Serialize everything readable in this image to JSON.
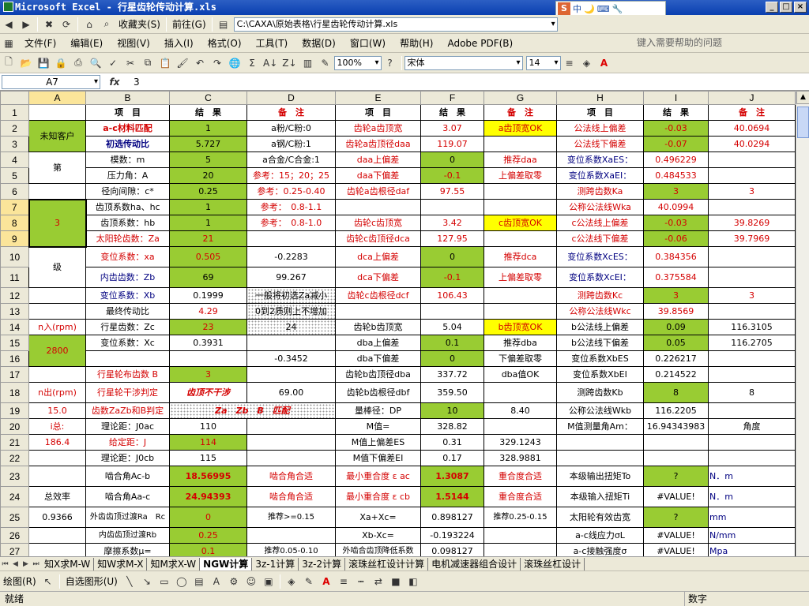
{
  "window": {
    "title": "Microsoft Excel - 行星齿轮传动计算.xls"
  },
  "ime": {
    "label1": "中",
    "label2": "🌙"
  },
  "nav": {
    "favorites": "收藏夹(S)",
    "goto": "前往(G)",
    "address": "C:\\CAXA\\原始表格\\行星齿轮传动计算.xls"
  },
  "menu": {
    "items": [
      "文件(F)",
      "编辑(E)",
      "视图(V)",
      "插入(I)",
      "格式(O)",
      "工具(T)",
      "数据(D)",
      "窗口(W)",
      "帮助(H)",
      "Adobe PDF(B)"
    ],
    "help_placeholder": "键入需要帮助的问题"
  },
  "toolbar": {
    "zoom": "100%",
    "font": "宋体",
    "size": "14"
  },
  "formula": {
    "cell": "A7",
    "fx": "fx",
    "value": "3"
  },
  "columns": [
    "A",
    "B",
    "C",
    "D",
    "E",
    "F",
    "G",
    "H",
    "I",
    "J"
  ],
  "rows": {
    "r1": [
      "",
      "项　目",
      "结　果",
      "备　注",
      "项　目",
      "结　果",
      "备　注",
      "项　目",
      "结　果",
      "备　注"
    ],
    "r2": [
      "a-c材料匹配",
      "1",
      "a粉/C粉:0",
      "齿轮a齿顶宽",
      "3.07",
      "a齿顶宽OK",
      "公法线上偏差",
      "-0.03",
      "40.0694"
    ],
    "r3": [
      "初选传动比",
      "5.727",
      "a钢/C粉:1",
      "齿轮a齿顶径daa",
      "119.07",
      "公法线下偏差",
      "-0.07",
      "40.0294"
    ],
    "r4": [
      "模数：m",
      "5",
      "a合金/C合金:1",
      "daa上偏差",
      "0",
      "推荐daa",
      "变位系数XaES：",
      "0.496229"
    ],
    "r5": [
      "压力角：A",
      "20",
      "参考：15；20；25",
      "daa下偏差",
      "-0.1",
      "上偏差取零",
      "变位系数XaEI：",
      "0.484533"
    ],
    "r6": [
      "径向间隙：c*",
      "0.25",
      "参考：0.25-0.40",
      "齿轮a齿根径daf",
      "97.55",
      "测跨齿数Ka",
      "3",
      "3"
    ],
    "r7": [
      "齿顶系数ha、hc",
      "1",
      "参考：　0.8-1.1",
      "公称公法线Wka",
      "40.0994"
    ],
    "r8": [
      "齿顶系数：hb",
      "1",
      "参考：　0.8-1.0",
      "齿轮c齿顶宽",
      "3.42",
      "c齿顶宽OK",
      "c公法线上偏差",
      "-0.03",
      "39.8269"
    ],
    "r9": [
      "太阳轮齿数：Za",
      "21",
      "齿轮c齿顶径dca",
      "127.95",
      "c公法线下偏差",
      "-0.06",
      "39.7969"
    ],
    "r10": [
      "变位系数：xa",
      "0.505",
      "-0.2283",
      "dca上偏差",
      "0",
      "推荐dca",
      "变位系数XcES：",
      "0.384356"
    ],
    "r11": [
      "内齿齿数：Zb",
      "69",
      "99.267",
      "dca下偏差",
      "-0.1",
      "上偏差取零",
      "变位系数XcEI：",
      "0.375584"
    ],
    "r12": [
      "变位系数：Xb",
      "0.1999",
      "一般将初选Za减小",
      "齿轮c齿根径dcf",
      "106.43",
      "测跨齿数Kc",
      "3",
      "3"
    ],
    "r13": [
      "最终传动比",
      "4.29",
      "0到2质则上不增加",
      "公称公法线Wkc",
      "39.8569"
    ],
    "r14": [
      "行星齿数：Zc",
      "23",
      "24",
      "齿轮b齿顶宽",
      "5.04",
      "b齿顶宽OK",
      "b公法线上偏差",
      "0.09",
      "116.3105"
    ],
    "r15": [
      "变位系数：Xc",
      "0.3931",
      "dba上偏差",
      "0.1",
      "推荐dba",
      "b公法线下偏差",
      "0.05",
      "116.2705"
    ],
    "r16": [
      "-0.3452",
      "dba下偏差",
      "0",
      "下偏差取零",
      "变位系数XbES",
      "0.226217"
    ],
    "r17": [
      "行星轮布齿数 B",
      "3",
      "齿轮b齿顶径dba",
      "337.72",
      "dba值OK",
      "变位系数XbEI",
      "0.214522"
    ],
    "r18": [
      "行星轮干涉判定",
      "齿顶不干涉",
      "69.00",
      "齿轮b齿根径dbf",
      "359.50",
      "测跨齿数Kb",
      "8",
      "8"
    ],
    "r19": [
      "齿数ZaZb和B判定",
      "Za　Zb　B　匹配",
      "量棒径：DP",
      "10",
      "8.40",
      "公称公法线Wkb",
      "116.2205"
    ],
    "r20": [
      "理论距：J0ac",
      "110",
      "M值=",
      "328.82",
      "M值测量角Am：",
      "16.94343983",
      "角度"
    ],
    "r21": [
      "给定距：J",
      "114",
      "M值上偏差ES",
      "0.31",
      "329.1243"
    ],
    "r22": [
      "理论距：J0cb",
      "115",
      "M值下偏差EI",
      "0.17",
      "328.9881"
    ],
    "r23": [
      "啮合角Ac-b",
      "18.56995",
      "啮合角合适",
      "最小重合度 ε ac",
      "1.3087",
      "重合度合适",
      "本级输出扭矩To",
      "?",
      "N．m"
    ],
    "r24": [
      "啮合角Aa-c",
      "24.94393",
      "啮合角合适",
      "最小重合度 ε cb",
      "1.5144",
      "重合度合适",
      "本级输入扭矩Ti",
      "#VALUE!",
      "N．m"
    ],
    "r25": [
      "外齿齿顶过渡Ra　Rc",
      "0",
      "推荐>=0.15",
      "Xa+Xc=",
      "0.898127",
      "推荐0.25-0.15",
      "太阳轮有效齿宽",
      "?",
      "mm"
    ],
    "r26": [
      "内齿齿顶过渡Rb",
      "0.25",
      "Xb-Xc=",
      "-0.193224",
      "a-c线应力σL",
      "#VALUE!",
      "N/mm"
    ],
    "r27": [
      "摩擦系数μ=",
      "0.1",
      "推荐0.05-0.10",
      "外啮合齿顶降低系数",
      "0.098127",
      "a-c接触强度σ",
      "#VALUE!",
      "Mpa"
    ]
  },
  "colA": {
    "unknown": "未知客户",
    "di": "第",
    "three": "3",
    "ji": "级",
    "nin": "n入(rpm)",
    "nin_val": "2800",
    "nout": "n出(rpm)",
    "nout_val": "15.0",
    "i_label": "i总:",
    "i_val": "186.4",
    "eff": "总效率",
    "eff_val": "0.9366"
  },
  "tabs": [
    "知X求M-W",
    "知W求M-X",
    "知M求X-W",
    "NGW计算",
    "3z-1计算",
    "3z-2计算",
    "滚珠丝杠设计计算",
    "电机减速器组合设计",
    "滚珠丝杠设计"
  ],
  "active_tab": 3,
  "drawbar": {
    "draw": "绘图(R)",
    "autoshape": "自选图形(U)"
  },
  "status": {
    "ready": "就绪",
    "num": "数字"
  }
}
